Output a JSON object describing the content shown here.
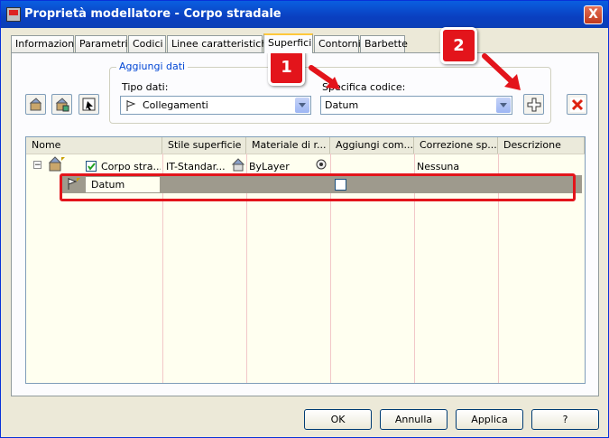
{
  "window": {
    "title": "Proprietà modellatore - Corpo stradale",
    "close_label": "X"
  },
  "tabs": [
    {
      "label": "Informazioni"
    },
    {
      "label": "Parametri"
    },
    {
      "label": "Codici"
    },
    {
      "label": "Linee caratteristiche"
    },
    {
      "label": "Superfici"
    },
    {
      "label": "Contorni"
    },
    {
      "label": "Barbette"
    }
  ],
  "add_data": {
    "group_label": "Aggiungi dati",
    "data_type_label": "Tipo dati:",
    "data_type_value": "Collegamenti",
    "code_label": "Specifica codice:",
    "code_value": "Datum"
  },
  "grid": {
    "columns": [
      "Nome",
      "Stile superficie",
      "Materiale di r...",
      "Aggiungi com...",
      "Correzione sp...",
      "Descrizione"
    ],
    "rows": [
      {
        "name": "Corpo stra...",
        "style": "IT-Standar...",
        "material": "ByLayer",
        "correction": "Nessuna",
        "checked": true
      },
      {
        "name": "Datum",
        "checked": false
      }
    ],
    "expand_symbol": "−"
  },
  "annotations": {
    "badge1": "1",
    "badge2": "2"
  },
  "buttons": {
    "ok": "OK",
    "cancel": "Annulla",
    "apply": "Applica",
    "help": "?"
  },
  "colors": {
    "highlight": "#e3141b",
    "title_bar": "#0a4fd0",
    "selected_row": "#9e9a8d"
  }
}
